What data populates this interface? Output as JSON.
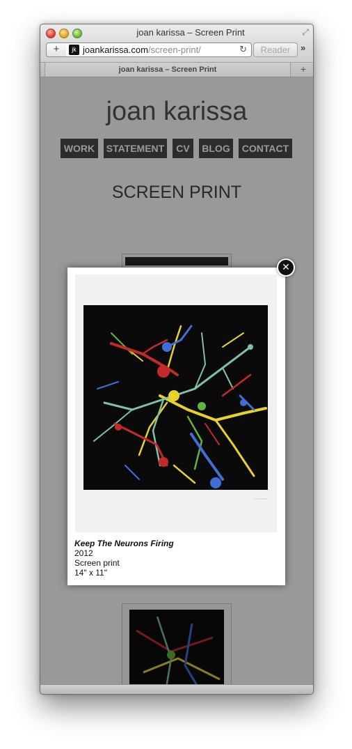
{
  "window": {
    "title": "joan karissa – Screen Print"
  },
  "toolbar": {
    "url_domain": "joankarissa.com",
    "url_path": "/screen-print/",
    "favicon_text": "jk",
    "reader_label": "Reader",
    "icons": {
      "add": "plus-icon",
      "reload": "reload-icon",
      "overflow": "chevrons-right-icon",
      "fullscreen": "fullscreen-icon"
    }
  },
  "tab": {
    "label": "joan karissa – Screen Print"
  },
  "site": {
    "title": "joan karissa",
    "nav": [
      "WORK",
      "STATEMENT",
      "CV",
      "BLOG",
      "CONTACT"
    ],
    "heading": "SCREEN PRINT"
  },
  "lightbox": {
    "title": "Keep The Neurons Firing",
    "year": "2012",
    "medium": "Screen print",
    "size": "14\" x 11\"",
    "close_icon": "close-icon"
  },
  "colors": {
    "nav_bg": "#4a4a4a",
    "splatter": [
      "#e8d22a",
      "#7fc4a0",
      "#c42a2a",
      "#3f6fd6",
      "#63b43a"
    ]
  }
}
